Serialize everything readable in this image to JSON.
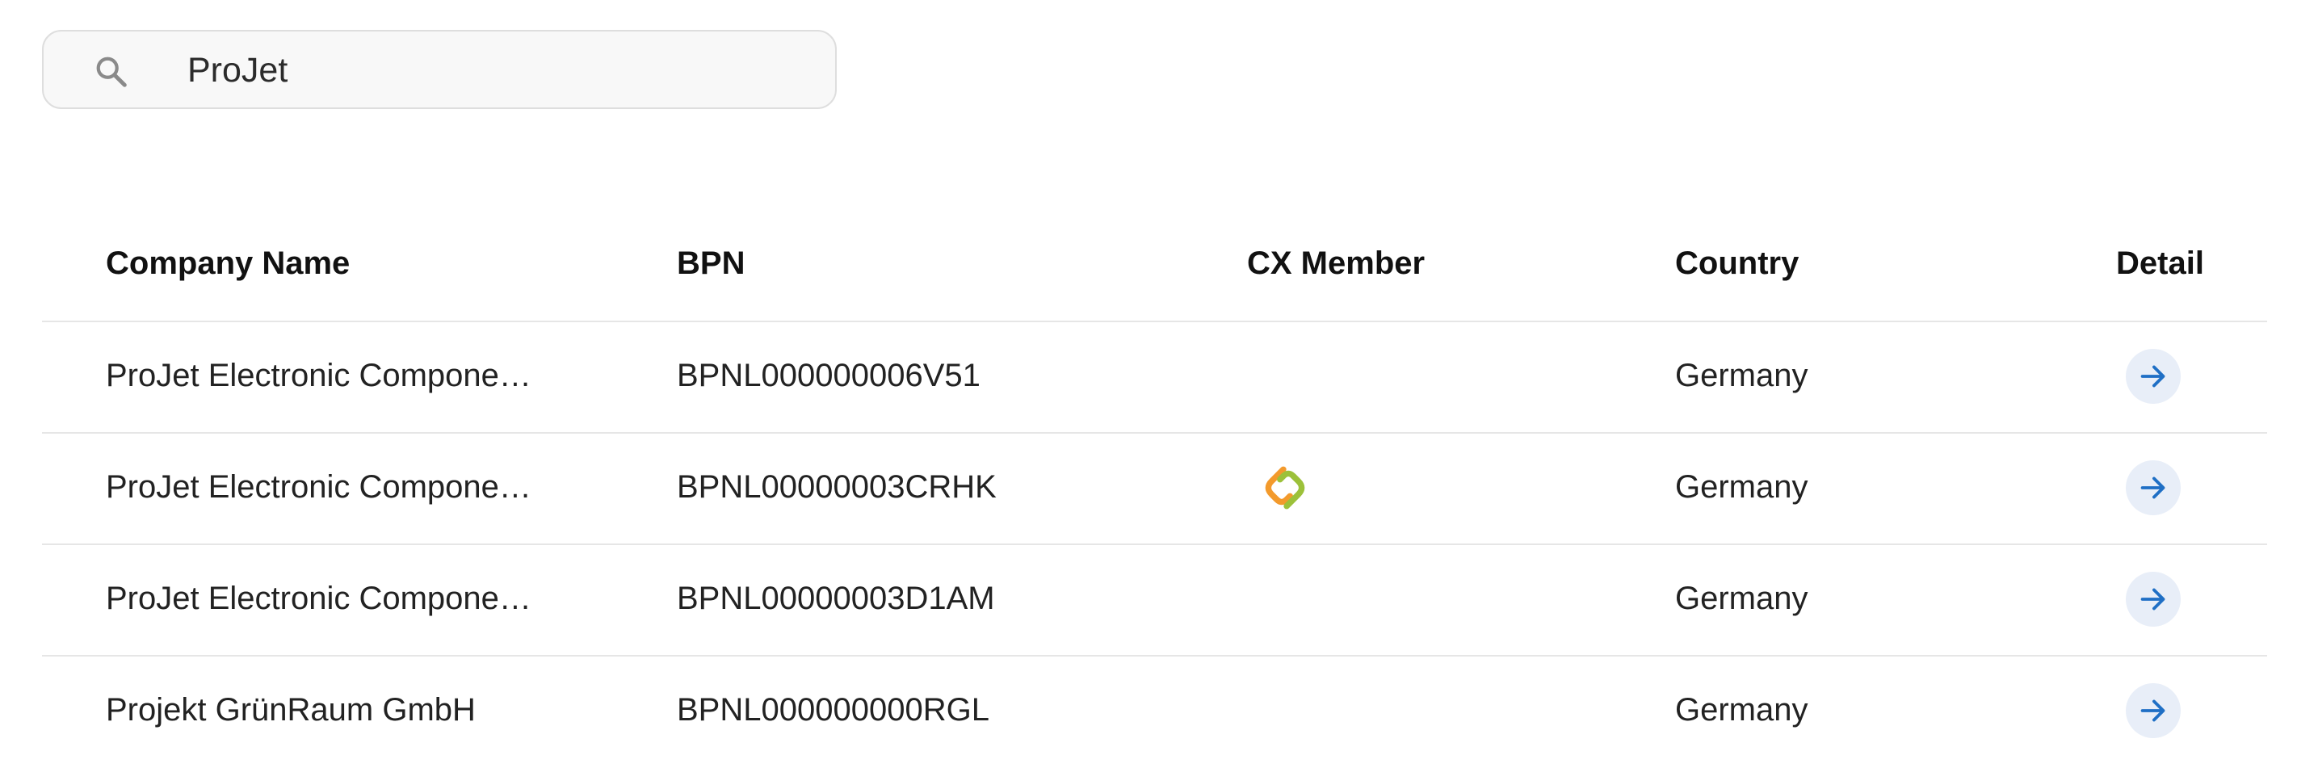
{
  "search": {
    "value": "ProJet",
    "icon": "search-icon"
  },
  "table": {
    "headers": {
      "company_name": "Company Name",
      "bpn": "BPN",
      "cx_member": "CX Member",
      "country": "Country",
      "detail": "Detail"
    },
    "rows": [
      {
        "company_name": "ProJet Electronic Componen...",
        "bpn": "BPNL000000006V51",
        "cx_member": false,
        "country": "Germany"
      },
      {
        "company_name": "ProJet Electronic Componen...",
        "bpn": "BPNL00000003CRHK",
        "cx_member": true,
        "country": "Germany"
      },
      {
        "company_name": "ProJet Electronic Componen...",
        "bpn": "BPNL00000003D1AM",
        "cx_member": false,
        "country": "Germany"
      },
      {
        "company_name": "Projekt GrünRaum GmbH",
        "bpn": "BPNL000000000RGL",
        "cx_member": false,
        "country": "Germany"
      }
    ]
  },
  "colors": {
    "accent": "#1f6fc5",
    "detail_bg": "#e8eef8",
    "cx_orange": "#f39a2c",
    "cx_green": "#9cc13a"
  }
}
